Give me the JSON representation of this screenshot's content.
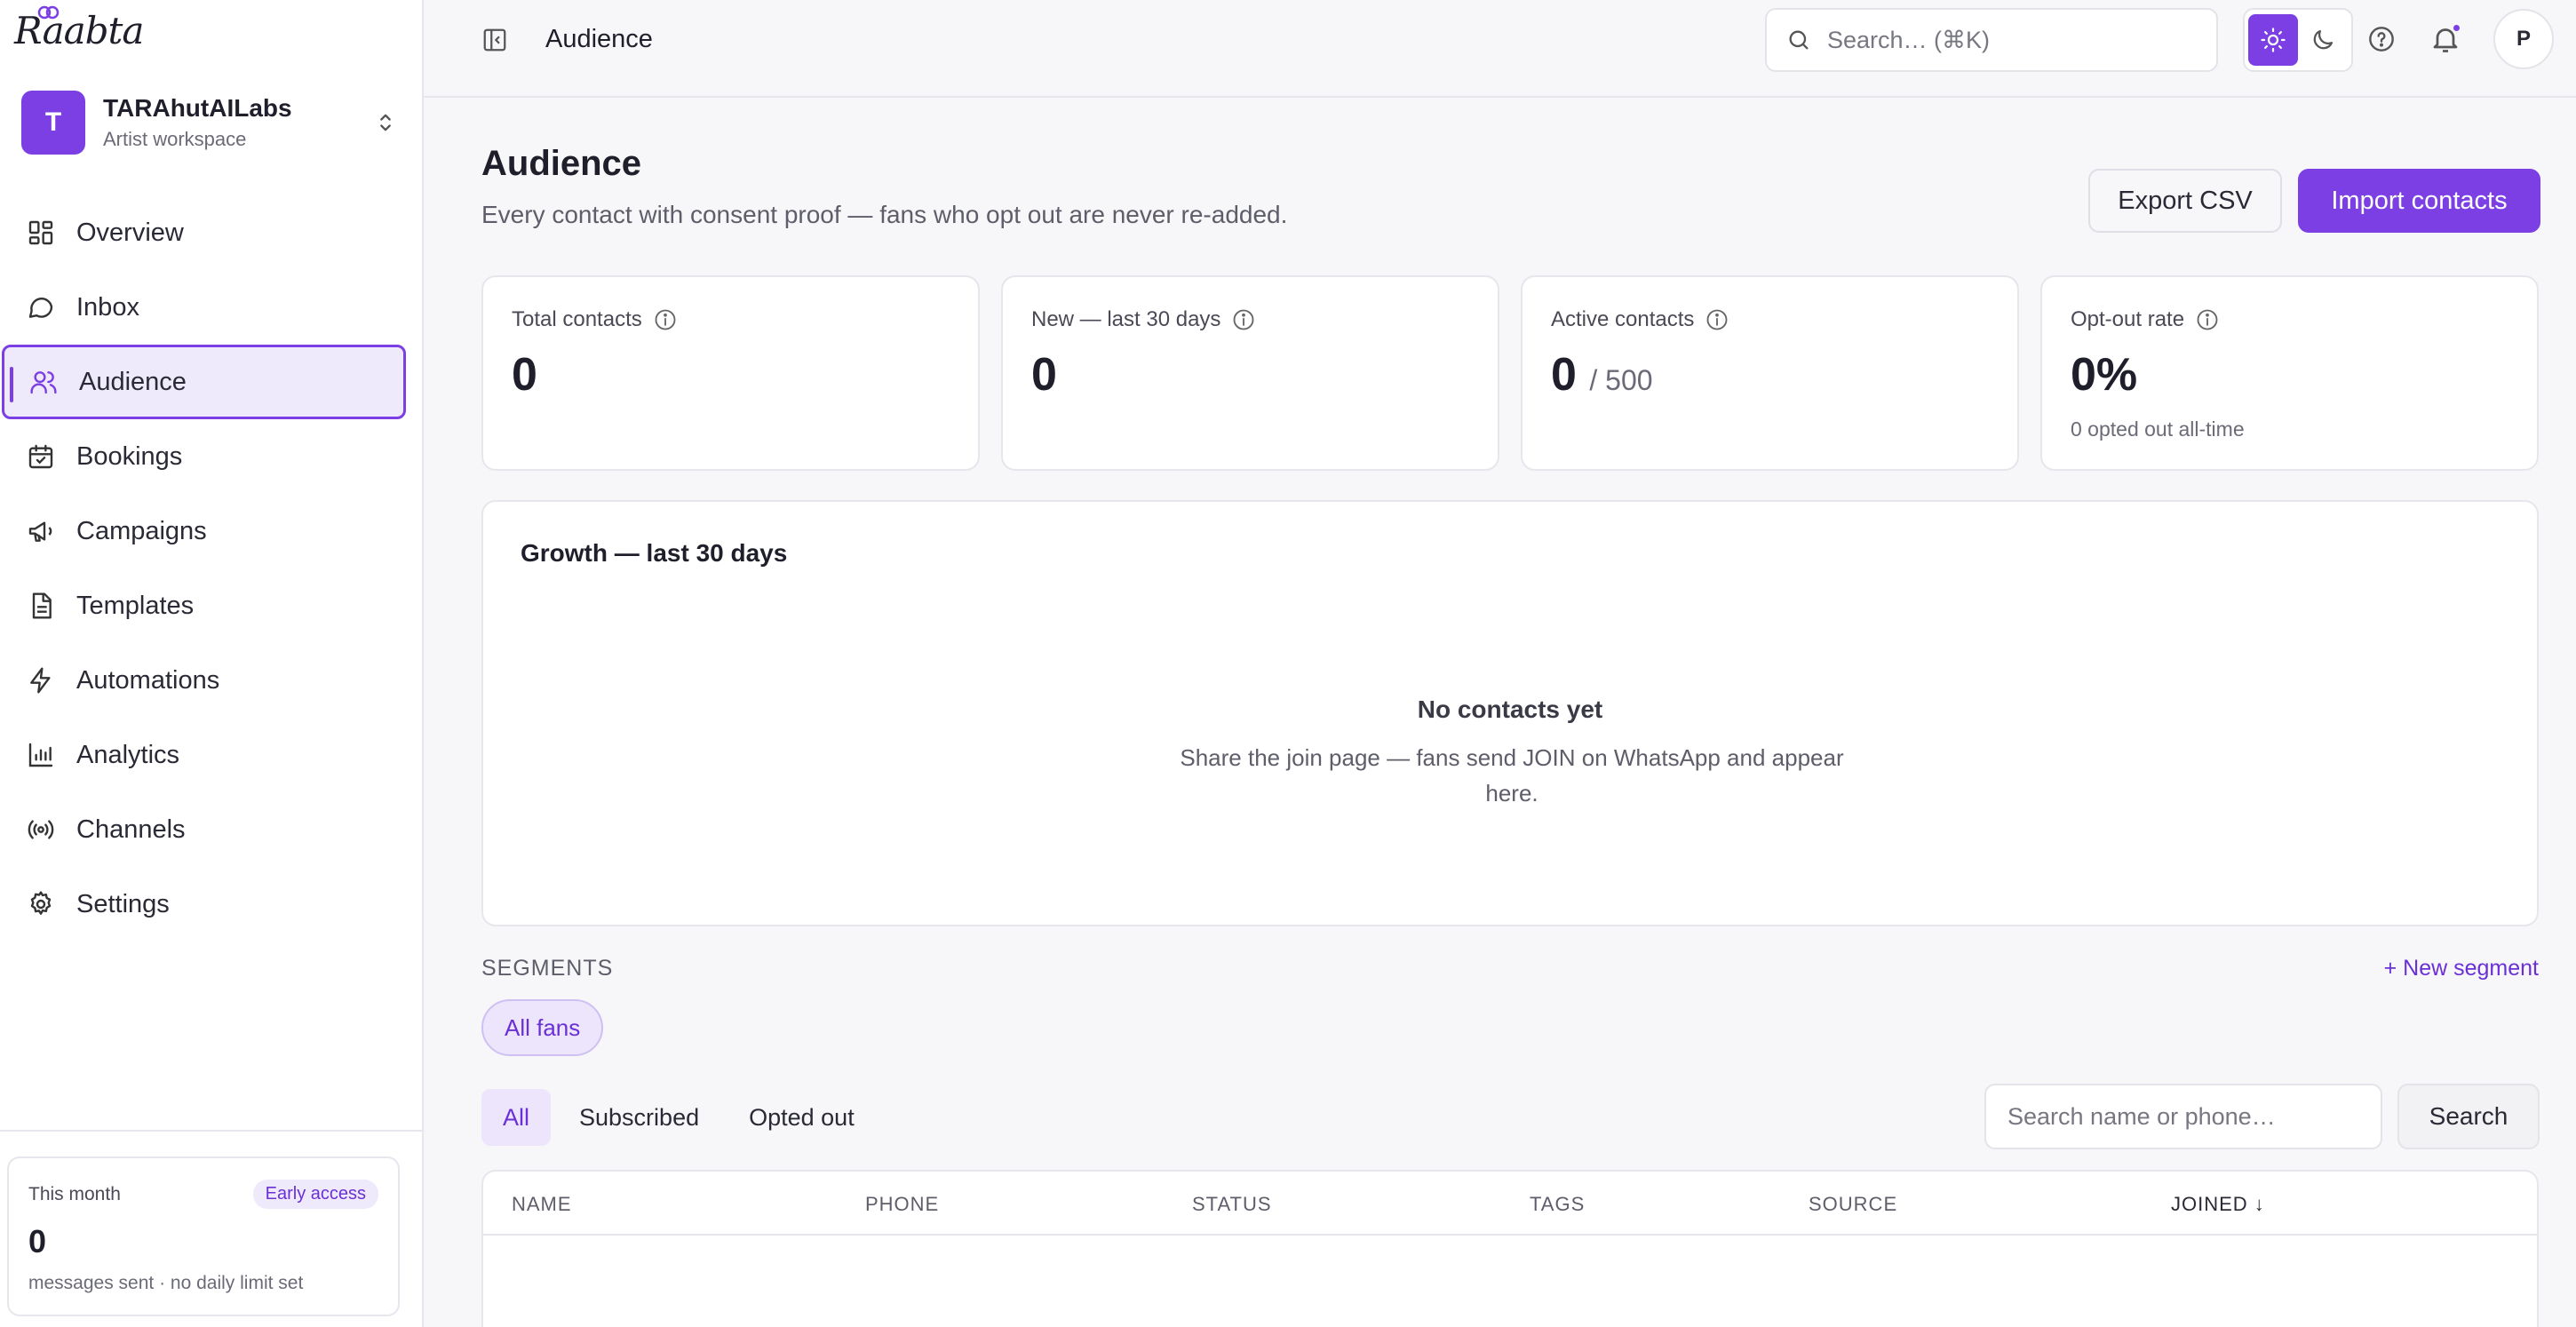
{
  "sidebar": {
    "logo_text": "Raabta",
    "workspace": {
      "initial": "T",
      "name": "TARAhutAILabs",
      "subtitle": "Artist workspace"
    },
    "items": [
      {
        "label": "Overview",
        "icon": "grid-icon"
      },
      {
        "label": "Inbox",
        "icon": "chat-bubble-icon"
      },
      {
        "label": "Audience",
        "icon": "users-icon",
        "active": true
      },
      {
        "label": "Bookings",
        "icon": "calendar-check-icon"
      },
      {
        "label": "Campaigns",
        "icon": "megaphone-icon"
      },
      {
        "label": "Templates",
        "icon": "document-icon"
      },
      {
        "label": "Automations",
        "icon": "lightning-icon"
      },
      {
        "label": "Analytics",
        "icon": "bar-chart-icon"
      },
      {
        "label": "Channels",
        "icon": "broadcast-icon"
      },
      {
        "label": "Settings",
        "icon": "gear-icon"
      }
    ],
    "usage": {
      "label": "This month",
      "badge": "Early access",
      "value": "0",
      "subtitle": "messages sent · no daily limit set"
    }
  },
  "topbar": {
    "title": "Audience",
    "search_placeholder": "Search… (⌘K)",
    "user_initial": "P"
  },
  "page": {
    "title": "Audience",
    "subtitle": "Every contact with consent proof — fans who opt out are never re-added.",
    "export_label": "Export CSV",
    "import_label": "Import contacts"
  },
  "stats": [
    {
      "label": "Total contacts",
      "value": "0"
    },
    {
      "label": "New — last 30 days",
      "value": "0"
    },
    {
      "label": "Active contacts",
      "value": "0",
      "of": "/ 500"
    },
    {
      "label": "Opt-out rate",
      "value": "0%",
      "sub": "0 opted out all-time"
    }
  ],
  "growth": {
    "title": "Growth — last 30 days",
    "empty_title": "No contacts yet",
    "empty_desc": "Share the join page — fans send JOIN on WhatsApp and appear here."
  },
  "segments": {
    "label": "SEGMENTS",
    "new_label": "+ New segment",
    "chips": [
      "All fans"
    ]
  },
  "filters": {
    "tabs": [
      "All",
      "Subscribed",
      "Opted out"
    ],
    "active_tab": "All",
    "search_placeholder": "Search name or phone…",
    "search_button": "Search"
  },
  "table": {
    "columns": [
      "NAME",
      "PHONE",
      "STATUS",
      "TAGS",
      "SOURCE",
      "JOINED ↓"
    ]
  },
  "colors": {
    "accent": "#7b3fe4",
    "accent_soft": "#efe9fc"
  }
}
